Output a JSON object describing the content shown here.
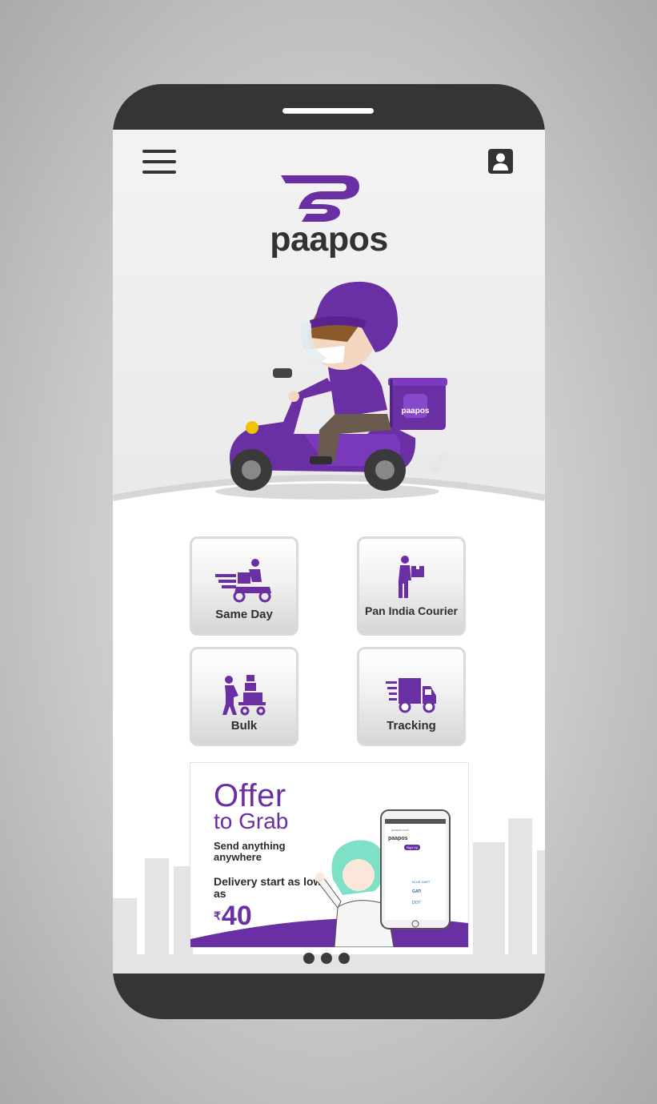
{
  "app": {
    "brand": "paapos",
    "accent_color": "#6a2fa3",
    "dark_color": "#353535"
  },
  "header": {
    "menu_icon": "hamburger-menu-icon",
    "profile_icon": "user-profile-icon"
  },
  "hero": {
    "illustration": "delivery-rider-on-scooter",
    "box_label": "paapos"
  },
  "services": [
    {
      "label": "Same Day",
      "icon": "scooter-delivery-icon"
    },
    {
      "label": "Pan India Courier",
      "icon": "courier-person-icon"
    },
    {
      "label": "Bulk",
      "icon": "trolley-boxes-icon"
    },
    {
      "label": "Tracking",
      "icon": "delivery-truck-icon"
    }
  ],
  "banner": {
    "title": "Offer",
    "subtitle": "to Grab",
    "tagline": "Send anything anywhere",
    "delivery_text": "Delivery start as low as",
    "currency": "₹",
    "price": "40",
    "phone_brand": "paapos",
    "phone_url": "paapos.com",
    "phone_button": "Sign Up",
    "phone_partners": [
      "BLUE DART",
      "GATI",
      "DOT"
    ]
  },
  "carousel": {
    "slides": 3,
    "active": 1
  }
}
